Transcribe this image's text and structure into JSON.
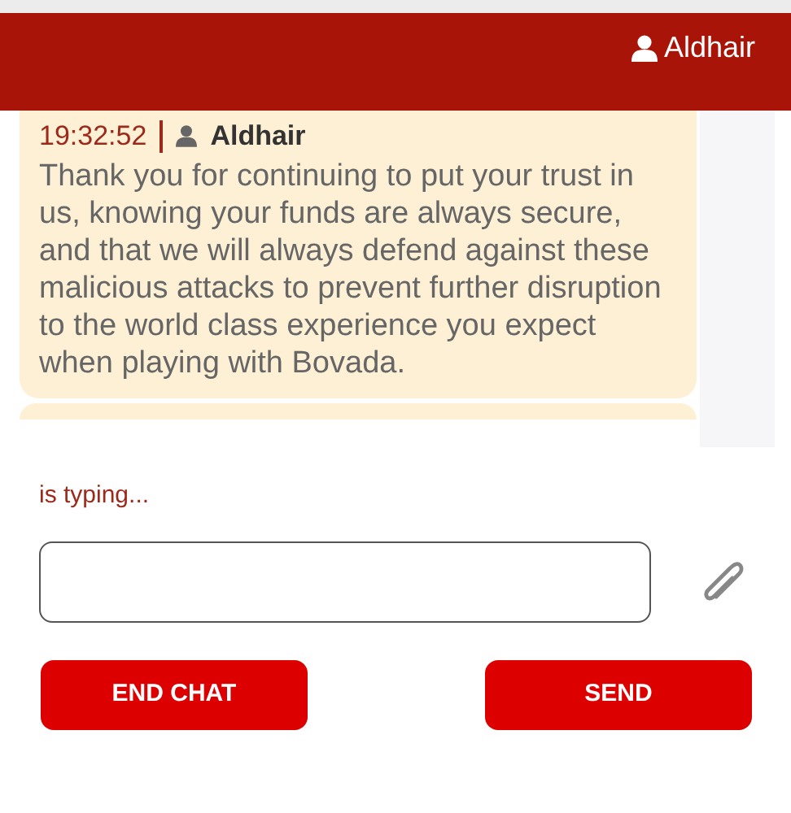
{
  "header": {
    "user": "Aldhair"
  },
  "messages": [
    {
      "time": "19:32:52",
      "author": "Aldhair",
      "text": "Thank you for continuing to put your trust in us, knowing your funds are always secure, and that we will always defend against these malicious attacks to prevent further disruption to the world class experience you expect when playing with Bovada."
    }
  ],
  "typing_indicator": "is typing...",
  "buttons": [
    "END CHAT",
    "SEND"
  ]
}
